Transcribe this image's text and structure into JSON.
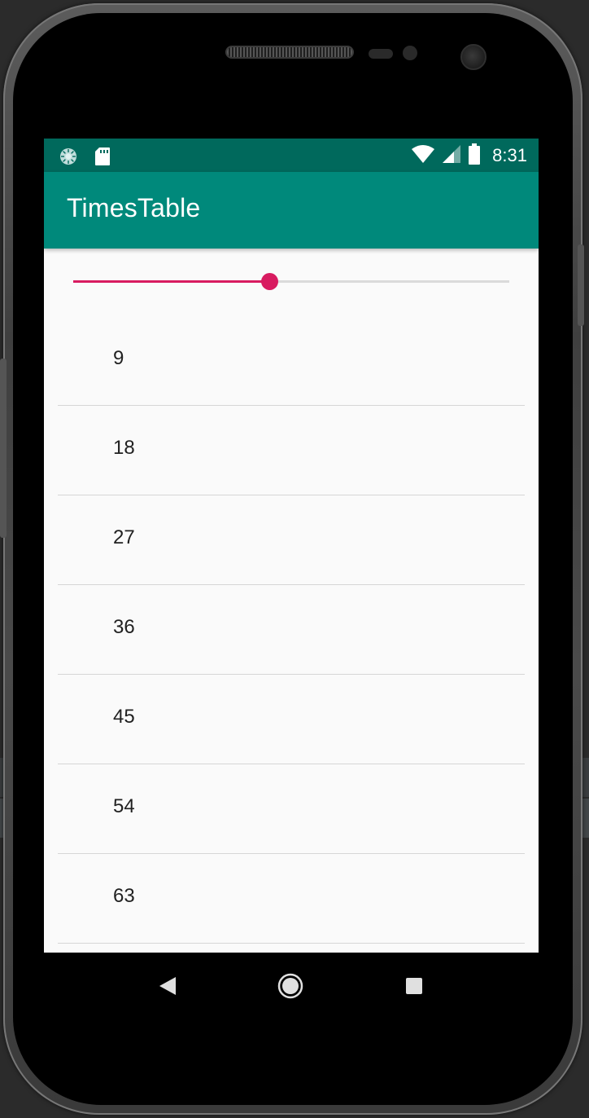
{
  "status_bar": {
    "time": "8:31",
    "icons": [
      "loading-icon",
      "sd-card-icon",
      "wifi-icon",
      "signal-icon",
      "battery-icon"
    ]
  },
  "app_bar": {
    "title": "TimesTable"
  },
  "seekbar": {
    "value_fraction": 0.45
  },
  "list": {
    "items": [
      "9",
      "18",
      "27",
      "36",
      "45",
      "54",
      "63"
    ]
  },
  "nav_bar": {
    "icons": [
      "back-icon",
      "home-icon",
      "recents-icon"
    ]
  },
  "colors": {
    "status_bar": "#00695c",
    "app_bar": "#00897b",
    "accent": "#d81b60",
    "background": "#fafafa",
    "text": "#212121",
    "divider": "#d6d6d6"
  }
}
